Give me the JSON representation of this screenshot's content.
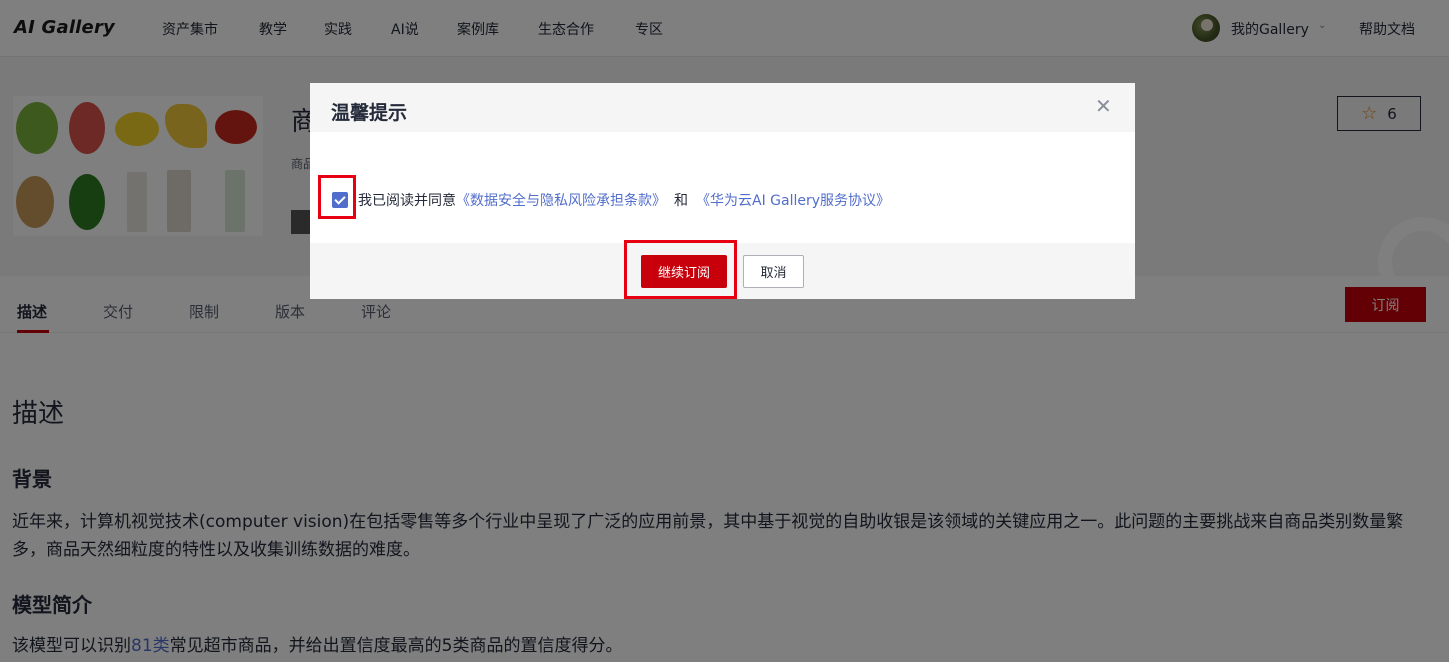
{
  "app": {
    "logo": "AI Gallery"
  },
  "nav": {
    "items": [
      "资产集市",
      "教学",
      "实践",
      "AI说",
      "案例库",
      "生态合作",
      "专区"
    ],
    "my_gallery": "我的Gallery",
    "help": "帮助文档"
  },
  "hero": {
    "title": "商",
    "subtitle": "商品",
    "favorite_count": "6"
  },
  "tabs": [
    "描述",
    "交付",
    "限制",
    "版本",
    "评论"
  ],
  "subscribe_label": "订阅",
  "content": {
    "heading": "描述",
    "background_title": "背景",
    "background_text": "近年来，计算机视觉技术(computer vision)在包括零售等多个行业中呈现了广泛的应用前景，其中基于视觉的自助收银是该领域的关键应用之一。此问题的主要挑战来自商品类别数量繁多，商品天然细粒度的特性以及收集训练数据的难度。",
    "model_title": "模型简介",
    "model_text_prefix": "该模型可以识别",
    "model_text_link": "81类",
    "model_text_suffix": "常见超市商品，并给出置信度最高的5类商品的置信度得分。"
  },
  "modal": {
    "title": "温馨提示",
    "checkbox_checked": true,
    "agree_prefix": "我已阅读并同意",
    "link_privacy": "《数据安全与隐私风险承担条款》",
    "and": "和",
    "link_service": "《华为云AI Gallery服务协议》",
    "continue_label": "继续订阅",
    "cancel_label": "取消"
  },
  "colors": {
    "brand_red": "#c7000b",
    "link_blue": "#526ecc",
    "highlight_red": "#e60012"
  }
}
